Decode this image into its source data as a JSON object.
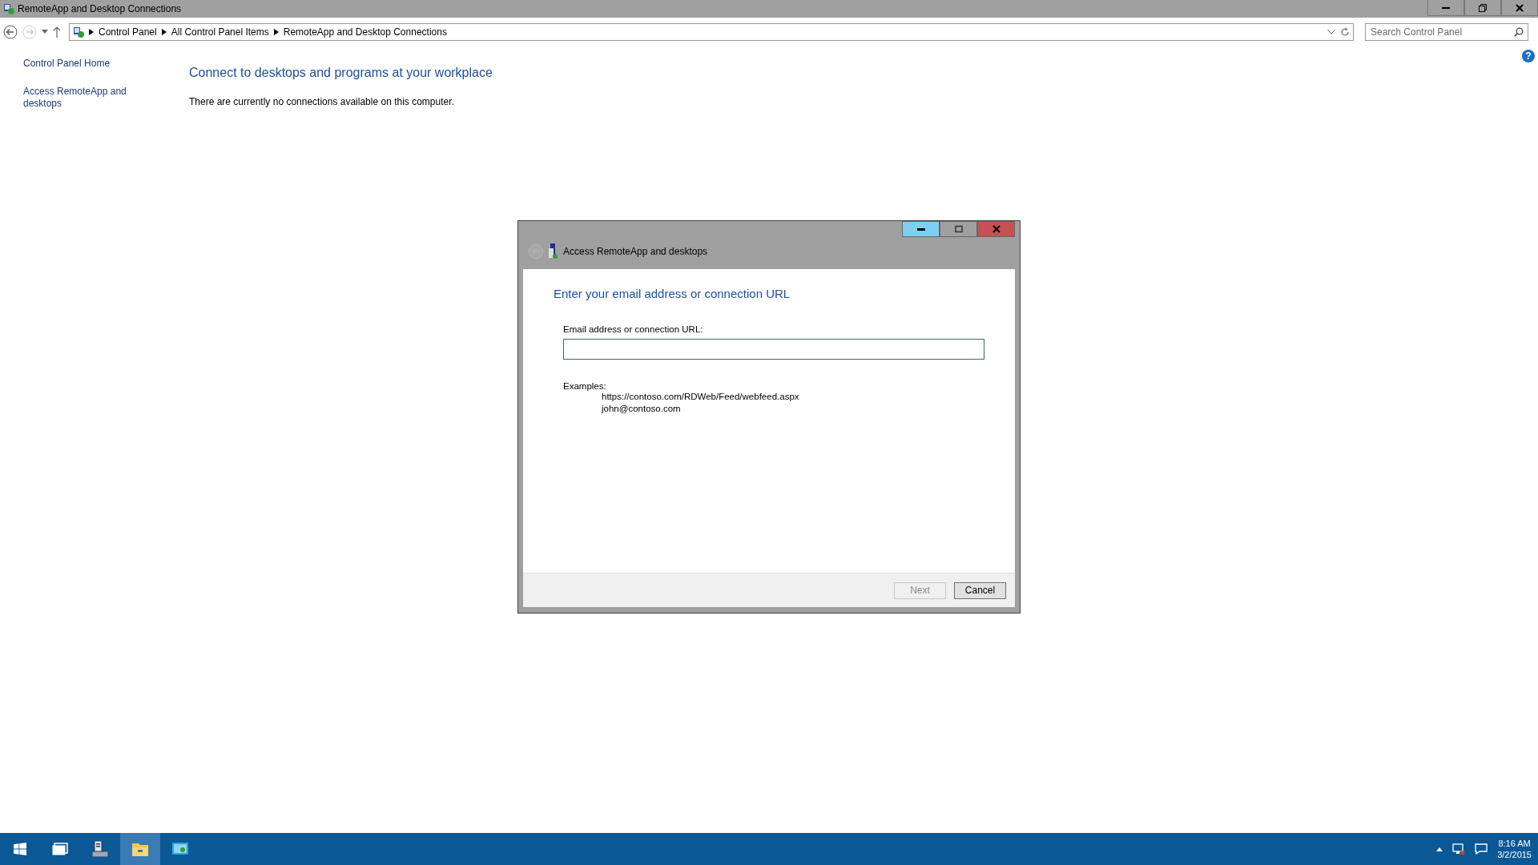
{
  "window": {
    "title": "RemoteApp and Desktop Connections"
  },
  "address_bar": {
    "breadcrumbs": [
      "Control Panel",
      "All Control Panel Items",
      "RemoteApp and Desktop Connections"
    ]
  },
  "search": {
    "placeholder": "Search Control Panel"
  },
  "sidebar": {
    "items": [
      "Control Panel Home",
      "Access RemoteApp and desktops"
    ]
  },
  "help": "?",
  "main": {
    "heading": "Connect to desktops and programs at your workplace",
    "message": "There are currently no connections available on this computer."
  },
  "dialog": {
    "title": "Access RemoteApp and desktops",
    "heading": "Enter your email address or connection URL",
    "field_label": "Email address or connection URL:",
    "examples_label": "Examples:",
    "examples": [
      "https://contoso.com/RDWeb/Feed/webfeed.aspx",
      "john@contoso.com"
    ],
    "buttons": [
      {
        "label": "Next",
        "disabled": true
      },
      {
        "label": "Cancel",
        "disabled": false
      }
    ]
  },
  "taskbar": {
    "apps": [
      {
        "kind": "server_manager",
        "selected": false
      },
      {
        "kind": "explorer",
        "selected": true
      },
      {
        "kind": "remoteapp",
        "selected": false
      }
    ],
    "clock": {
      "time": "8:16 AM",
      "date": "3/2/2015"
    }
  }
}
